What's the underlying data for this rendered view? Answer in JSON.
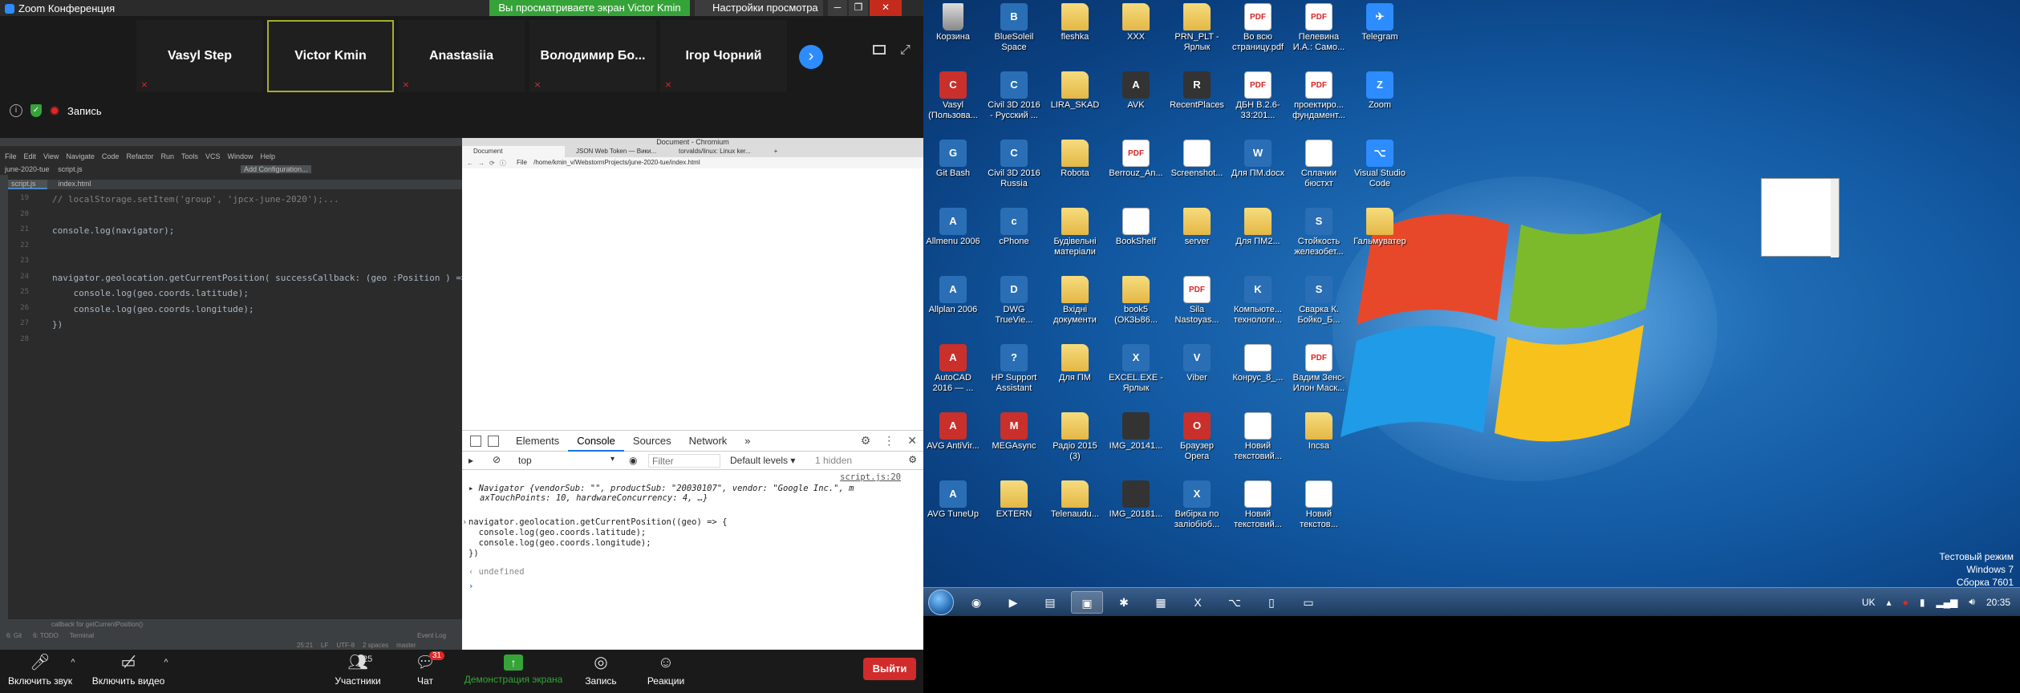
{
  "zoom": {
    "window_title": "Zoom Конференция",
    "share_banner": "Вы просматриваете экран Victor Kmin",
    "view_options": "Настройки просмотра",
    "participants": [
      {
        "name": "Vasyl Step",
        "muted": true,
        "active": false
      },
      {
        "name": "Victor Kmin",
        "muted": false,
        "active": true
      },
      {
        "name": "Anastasiia",
        "muted": true,
        "active": false
      },
      {
        "name": "Володимир Бо...",
        "muted": true,
        "active": false
      },
      {
        "name": "Ігор Чорний",
        "muted": true,
        "active": false
      }
    ],
    "recording_label": "Запись",
    "toolbar": {
      "unmute": "Включить звук",
      "start_video": "Включить видео",
      "participants": "Участники",
      "participants_count": "25",
      "chat": "Чат",
      "chat_badge": "31",
      "share_screen": "Демонстрация экрана",
      "record": "Запись",
      "reactions": "Реакции",
      "leave": "Выйти"
    },
    "colors": {
      "accent_blue": "#2d8cff",
      "share_green": "#36a339",
      "leave_red": "#d12b2b"
    }
  },
  "ide": {
    "menu": [
      "File",
      "Edit",
      "View",
      "Navigate",
      "Code",
      "Refactor",
      "Run",
      "Tools",
      "VCS",
      "Window",
      "Help"
    ],
    "project": "june-2020-tue",
    "nav_file": "script.js",
    "config_button": "Add Configuration...",
    "tabs": [
      "script.js",
      "index.html"
    ],
    "code_lines": [
      {
        "n": "19",
        "text": "// localStorage.setItem('group', 'jpcx-june-2020');...",
        "comment": true
      },
      {
        "n": "20",
        "text": "",
        "comment": false
      },
      {
        "n": "21",
        "text": "console.log(navigator);",
        "comment": false
      },
      {
        "n": "22",
        "text": "",
        "comment": false
      },
      {
        "n": "23",
        "text": "",
        "comment": false
      },
      {
        "n": "24",
        "text": "navigator.geolocation.getCurrentPosition( successCallback: (geo :Position ) => {",
        "comment": false
      },
      {
        "n": "25",
        "text": "    console.log(geo.coords.latitude);",
        "comment": false
      },
      {
        "n": "26",
        "text": "    console.log(geo.coords.longitude);",
        "comment": false
      },
      {
        "n": "27",
        "text": "})",
        "comment": false
      },
      {
        "n": "28",
        "text": "",
        "comment": false
      }
    ],
    "hint": "callback for getCurrentPosition()",
    "bottom_tools": [
      "6: Git",
      "6: TODO",
      "Terminal"
    ],
    "event_log": "Event Log",
    "status": [
      "25:21",
      "LF",
      "UTF-8",
      "2 spaces",
      "master"
    ]
  },
  "chromium": {
    "window_title": "Document - Chromium",
    "tabs": [
      "Document",
      "JSON Web Token — Вики...",
      "torvalds/linux: Linux ker..."
    ],
    "new_tab": "+",
    "url_prefix": "File",
    "url": "/home/kmin_v/WebstormProjects/june-2020-tue/index.html"
  },
  "devtools": {
    "tabs": [
      "Elements",
      "Console",
      "Sources",
      "Network"
    ],
    "more": "»",
    "context": "top",
    "filter_placeholder": "Filter",
    "levels": "Default levels",
    "hidden": "1 hidden",
    "source_link": "script.js:20",
    "navigator_line1_prefix": "Navigator",
    "navigator_line1_body": "{vendorSub: \"\", productSub: \"20030107\", vendor: \"Google Inc.\", m",
    "navigator_line2": "axTouchPoints: 10, hardwareConcurrency: 4, …}",
    "cmd_lines": [
      "navigator.geolocation.getCurrentPosition((geo) => {",
      "  console.log(geo.coords.latitude);",
      "  console.log(geo.coords.longitude);",
      "})"
    ],
    "result": "undefined"
  },
  "desktop": {
    "icons": [
      {
        "label": "Корзина",
        "kind": "bin",
        "glyph": ""
      },
      {
        "label": "BlueSoleil Space",
        "kind": "app",
        "glyph": "B"
      },
      {
        "label": "fleshka",
        "kind": "folder",
        "glyph": ""
      },
      {
        "label": "XXX",
        "kind": "folder",
        "glyph": ""
      },
      {
        "label": "PRN_PLT - Ярлык",
        "kind": "folder",
        "glyph": ""
      },
      {
        "label": "Во всю страницу.pdf",
        "kind": "pdf",
        "glyph": "PDF"
      },
      {
        "label": "Пелевина И.А.: Само...",
        "kind": "pdf",
        "glyph": "PDF"
      },
      {
        "label": "Telegram",
        "kind": "blue",
        "glyph": "✈"
      },
      {
        "label": "Vasyl (Пользова...",
        "kind": "red",
        "glyph": "C"
      },
      {
        "label": "Civil 3D 2016 - Русский ...",
        "kind": "app",
        "glyph": "C"
      },
      {
        "label": "LIRA_SKAD",
        "kind": "folder",
        "glyph": ""
      },
      {
        "label": "AVK",
        "kind": "dark",
        "glyph": "A"
      },
      {
        "label": "RecentPlaces",
        "kind": "dark",
        "glyph": "R"
      },
      {
        "label": "ДБН В.2.6-33:201...",
        "kind": "pdf",
        "glyph": "PDF"
      },
      {
        "label": "проектиро... фундамент...",
        "kind": "pdf",
        "glyph": "PDF"
      },
      {
        "label": "Zoom",
        "kind": "blue",
        "glyph": "Z"
      },
      {
        "label": "Git Bash",
        "kind": "app",
        "glyph": "G"
      },
      {
        "label": "Civil 3D 2016 Russia",
        "kind": "app",
        "glyph": "C"
      },
      {
        "label": "Robota",
        "kind": "folder",
        "glyph": ""
      },
      {
        "label": "Berrouz_An...",
        "kind": "pdf",
        "glyph": "PDF"
      },
      {
        "label": "Screenshot...",
        "kind": "doc",
        "glyph": ""
      },
      {
        "label": "Для ПМ.docx",
        "kind": "app",
        "glyph": "W"
      },
      {
        "label": "Сплачии бюстхт",
        "kind": "doc",
        "glyph": ""
      },
      {
        "label": "Visual Studio Code",
        "kind": "blue",
        "glyph": "⌥"
      },
      {
        "label": "Allmenu 2006",
        "kind": "app",
        "glyph": "A"
      },
      {
        "label": "cPhone",
        "kind": "app",
        "glyph": "c"
      },
      {
        "label": "Будівельні матеріали",
        "kind": "folder",
        "glyph": ""
      },
      {
        "label": "BookShelf",
        "kind": "doc",
        "glyph": ""
      },
      {
        "label": "server",
        "kind": "folder",
        "glyph": ""
      },
      {
        "label": "Для ПМ2...",
        "kind": "folder",
        "glyph": ""
      },
      {
        "label": "Стойкость железобет...",
        "kind": "app",
        "glyph": "S"
      },
      {
        "label": "Гальмуватер",
        "kind": "folder",
        "glyph": ""
      },
      {
        "label": "Allplan 2006",
        "kind": "app",
        "glyph": "A"
      },
      {
        "label": "DWG TrueVie...",
        "kind": "app",
        "glyph": "D"
      },
      {
        "label": "Вхідні документи",
        "kind": "folder",
        "glyph": ""
      },
      {
        "label": "book5 (ОКЗЬ86...",
        "kind": "folder",
        "glyph": ""
      },
      {
        "label": "Sila Nastoyas...",
        "kind": "pdf",
        "glyph": "PDF"
      },
      {
        "label": "Компьюте... технологи...",
        "kind": "app",
        "glyph": "K"
      },
      {
        "label": "Сварка К. Бойко_Б...",
        "kind": "app",
        "glyph": "S"
      },
      {
        "label": "",
        "kind": "none",
        "glyph": ""
      },
      {
        "label": "AutoCAD 2016 — ...",
        "kind": "red",
        "glyph": "A"
      },
      {
        "label": "HP Support Assistant",
        "kind": "app",
        "glyph": "?"
      },
      {
        "label": "Для ПМ",
        "kind": "folder",
        "glyph": ""
      },
      {
        "label": "EXCEL.EXE - Ярлык",
        "kind": "app",
        "glyph": "X"
      },
      {
        "label": "Viber",
        "kind": "app",
        "glyph": "V"
      },
      {
        "label": "Конрус_8_...",
        "kind": "doc",
        "glyph": ""
      },
      {
        "label": "Вадим Зенс- Илон Маск...",
        "kind": "pdf",
        "glyph": "PDF"
      },
      {
        "label": "",
        "kind": "none",
        "glyph": ""
      },
      {
        "label": "AVG AntiVir...",
        "kind": "red",
        "glyph": "A"
      },
      {
        "label": "MEGAsync",
        "kind": "red",
        "glyph": "M"
      },
      {
        "label": "Радіо 2015 (3)",
        "kind": "folder",
        "glyph": ""
      },
      {
        "label": "IMG_20141...",
        "kind": "dark",
        "glyph": ""
      },
      {
        "label": "Браузер Opera",
        "kind": "red",
        "glyph": "O"
      },
      {
        "label": "Новий текстовий...",
        "kind": "doc",
        "glyph": ""
      },
      {
        "label": "Incsa",
        "kind": "folder",
        "glyph": ""
      },
      {
        "label": "",
        "kind": "none",
        "glyph": ""
      },
      {
        "label": "AVG TuneUp",
        "kind": "app",
        "glyph": "A"
      },
      {
        "label": "EXTERN",
        "kind": "folder",
        "glyph": ""
      },
      {
        "label": "Telenaudu...",
        "kind": "folder",
        "glyph": ""
      },
      {
        "label": "IMG_20181...",
        "kind": "dark",
        "glyph": ""
      },
      {
        "label": "Вибірка по заліобіоб...",
        "kind": "app",
        "glyph": "X"
      },
      {
        "label": "Новий текстовий...",
        "kind": "doc",
        "glyph": ""
      },
      {
        "label": "Новий текстов...",
        "kind": "doc",
        "glyph": ""
      }
    ],
    "watermark": [
      "Тестовый режим",
      "Windows 7",
      "Сборка 7601"
    ],
    "taskbar": {
      "lang": "UK",
      "clock": "20:35"
    },
    "colors": {
      "wallpaper": "#1259a2",
      "taskbar": "#1c3a5e"
    }
  }
}
